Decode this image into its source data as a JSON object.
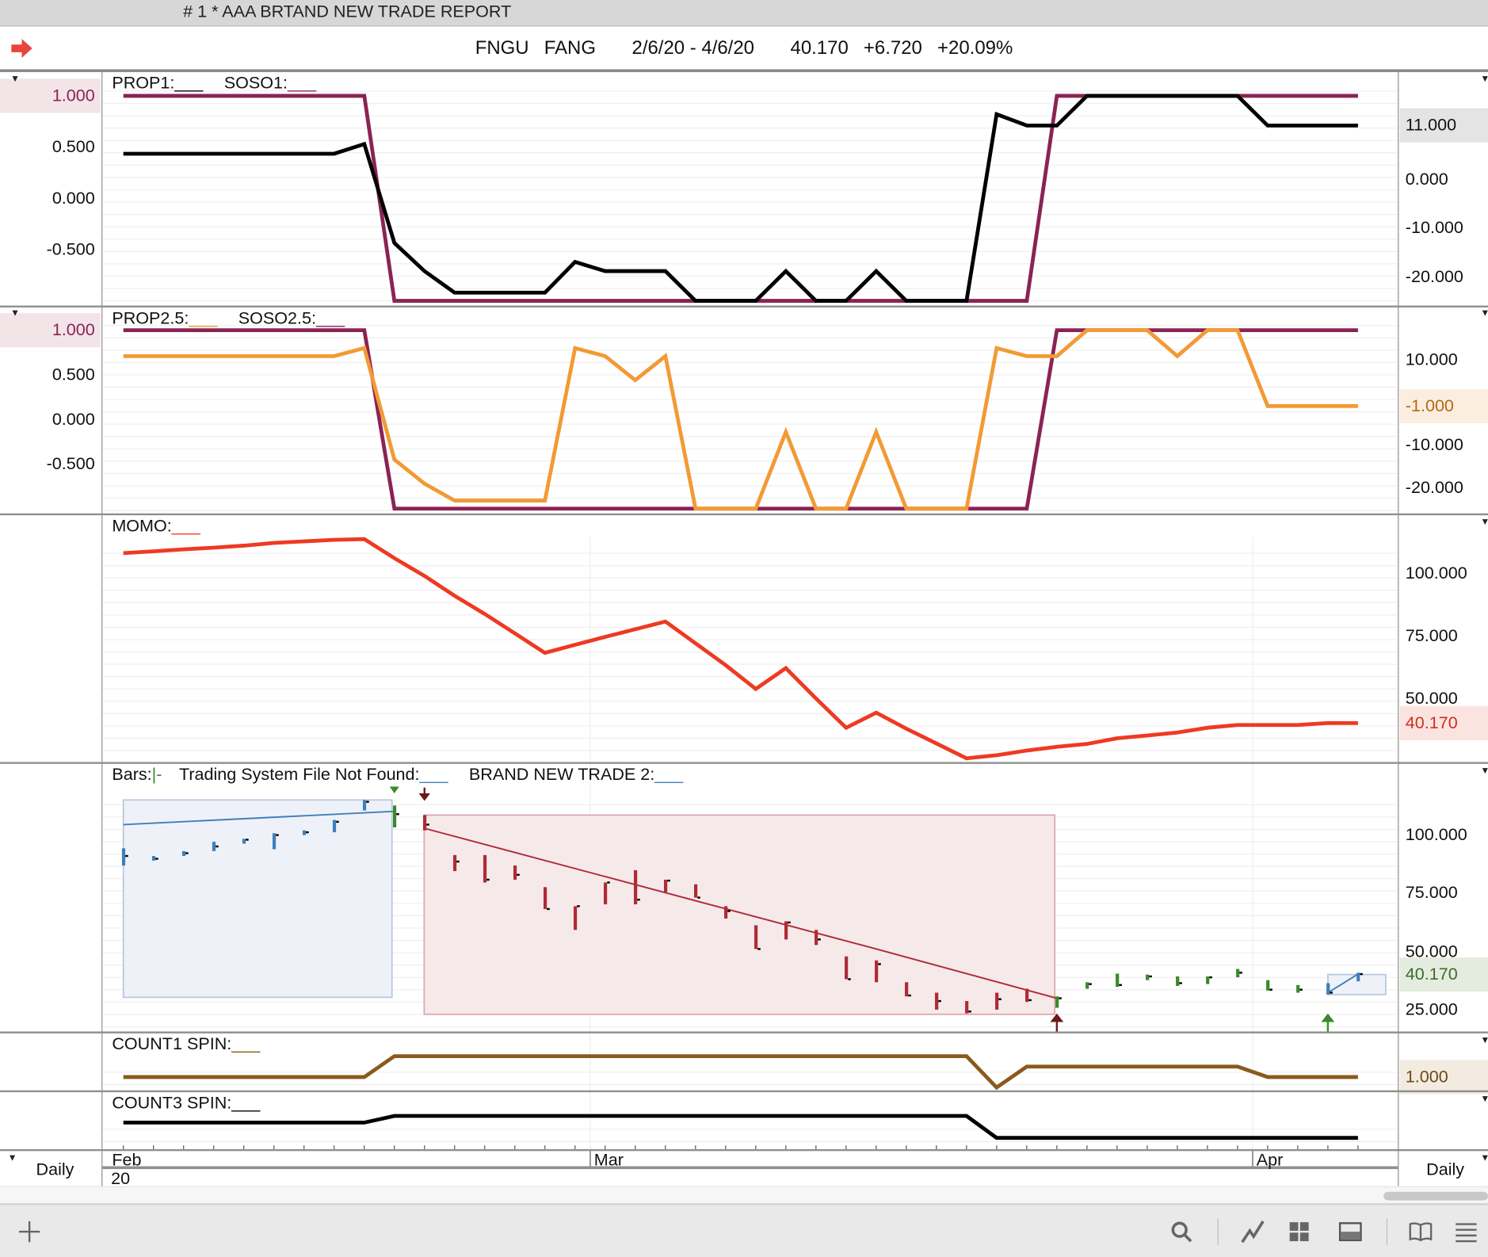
{
  "window": {
    "title": "# 1 * AAA BRTAND NEW TRADE REPORT"
  },
  "header": {
    "symbol": "FNGU",
    "name": "FANG",
    "range": "2/6/20 - 4/6/20",
    "last": "40.170",
    "change": "+6.720",
    "pct": "+20.09%",
    "icon": "red-arrow-right-icon"
  },
  "colors": {
    "purple": "#8b2354",
    "black": "#000000",
    "orange": "#f29a35",
    "momo": "#ee3a22",
    "blue": "#3f7fba",
    "green": "#3a8a2a",
    "red": "#b02a36",
    "brown": "#8a5a1c",
    "arrow_dark": "#6b1a1a"
  },
  "x_axis": {
    "months": [
      "Feb",
      "Mar",
      "Apr"
    ],
    "year": "20",
    "period_left": "Daily",
    "period_right": "Daily",
    "days": 42
  },
  "toolbar": {
    "icons": [
      "plus-icon",
      "search-icon",
      "line-chart-icon",
      "grid-icon",
      "panel-icon",
      "book-icon",
      "list-icon"
    ]
  },
  "chart_data": [
    {
      "id": "p1",
      "type": "line",
      "legend": [
        {
          "label": "PROP1:",
          "swatch": "___"
        },
        {
          "label": "SOSO1:",
          "swatch": "___"
        }
      ],
      "left_ticks": [
        "1.000",
        "0.500",
        "0.000",
        "-0.500"
      ],
      "right_ticks": [
        "11.000",
        "0.000",
        "-10.000",
        "-20.000"
      ],
      "ylim": [
        -1,
        1
      ],
      "series": [
        {
          "name": "SOSO1",
          "color": "purple",
          "values": [
            1,
            1,
            1,
            1,
            1,
            1,
            1,
            1,
            1,
            -1,
            -1,
            -1,
            -1,
            -1,
            -1,
            -1,
            -1,
            -1,
            -1,
            -1,
            -1,
            -1,
            -1,
            -1,
            -1,
            -1,
            -1,
            -1,
            -1,
            -1,
            -1,
            1,
            1,
            1,
            1,
            1,
            1,
            1,
            1,
            1,
            1,
            1
          ]
        },
        {
          "name": "PROP1",
          "color": "black",
          "values": [
            0.435,
            0.435,
            0.435,
            0.435,
            0.435,
            0.435,
            0.435,
            0.435,
            0.53,
            -0.435,
            -0.71,
            -0.92,
            -0.92,
            -0.92,
            -0.92,
            -0.62,
            -0.71,
            -0.71,
            -0.71,
            -1,
            -1,
            -1,
            -0.71,
            -1,
            -1,
            -0.71,
            -1,
            -1,
            -1,
            0.82,
            0.71,
            0.71,
            1,
            1,
            1,
            1,
            1,
            1,
            0.71,
            0.71,
            0.71,
            0.71
          ]
        }
      ]
    },
    {
      "id": "p2",
      "type": "line",
      "legend": [
        {
          "label": "PROP2.5:",
          "swatch": "___"
        },
        {
          "label": "SOSO2.5:",
          "swatch": "___"
        }
      ],
      "left_ticks": [
        "1.000",
        "0.500",
        "0.000",
        "-0.500"
      ],
      "right_ticks": [
        "10.000",
        "-1.000",
        "-10.000",
        "-20.000"
      ],
      "ylim": [
        -1,
        1
      ],
      "series": [
        {
          "name": "SOSO2.5",
          "color": "purple",
          "values": [
            1,
            1,
            1,
            1,
            1,
            1,
            1,
            1,
            1,
            -1,
            -1,
            -1,
            -1,
            -1,
            -1,
            -1,
            -1,
            -1,
            -1,
            -1,
            -1,
            -1,
            -1,
            -1,
            -1,
            -1,
            -1,
            -1,
            -1,
            -1,
            -1,
            1,
            1,
            1,
            1,
            1,
            1,
            1,
            1,
            1,
            1,
            1
          ]
        },
        {
          "name": "PROP2.5",
          "color": "orange",
          "values": [
            0.71,
            0.71,
            0.71,
            0.71,
            0.71,
            0.71,
            0.71,
            0.71,
            0.8,
            -0.45,
            -0.72,
            -0.91,
            -0.91,
            -0.91,
            -0.91,
            0.8,
            0.71,
            0.44,
            0.71,
            -1,
            -1,
            -1,
            -0.14,
            -1,
            -1,
            -0.14,
            -1,
            -1,
            -1,
            0.8,
            0.71,
            0.71,
            1,
            1,
            1,
            0.71,
            1,
            1,
            0.15,
            0.15,
            0.15,
            0.15
          ]
        }
      ]
    },
    {
      "id": "p3",
      "type": "line",
      "legend": [
        {
          "label": "MOMO:",
          "swatch": "___"
        }
      ],
      "right_ticks": [
        "100.000",
        "75.000",
        "50.000",
        "40.170"
      ],
      "series": [
        {
          "name": "MOMO",
          "color": "momo",
          "values": [
            108,
            108.7,
            109.5,
            110.2,
            111,
            112.1,
            112.7,
            113.3,
            113.6,
            106,
            98.9,
            91,
            83.7,
            76,
            68.2,
            71.4,
            74.6,
            77.6,
            80.7,
            72,
            63.3,
            53.8,
            62.1,
            50,
            38.3,
            44.3,
            37.9,
            32,
            26.1,
            27.3,
            29.2,
            30.7,
            31.8,
            34.1,
            35.2,
            36.4,
            38.3,
            39.4,
            39.4,
            39.4,
            40.2,
            40.17
          ]
        }
      ]
    },
    {
      "id": "p4",
      "type": "bar",
      "legend": {
        "bars_label": "Bars:",
        "bars_glyph": "|-",
        "items": [
          {
            "label": "Trading System File Not Found:",
            "swatch": "___"
          },
          {
            "label": "BRAND NEW TRADE 2:",
            "swatch": "___"
          }
        ]
      },
      "right_ticks": [
        "100.000",
        "75.000",
        "50.000",
        "40.170",
        "25.000"
      ],
      "bars_hlc_color": [
        [
          94.3,
          86.9,
          91.0,
          "blue"
        ],
        [
          91.0,
          89.0,
          89.8,
          "blue"
        ],
        [
          93.1,
          91.0,
          92.2,
          "blue"
        ],
        [
          97.1,
          93.1,
          95.1,
          "blue"
        ],
        [
          98.4,
          96.3,
          98.0,
          "blue"
        ],
        [
          100.8,
          93.9,
          100,
          "blue"
        ],
        [
          102,
          100,
          101.2,
          "blue"
        ],
        [
          106.5,
          101.2,
          105.7,
          "blue"
        ],
        [
          115.1,
          110.6,
          114.3,
          "blue"
        ],
        [
          112.7,
          103.3,
          109,
          "green"
        ],
        [
          108.6,
          102,
          104.5,
          "red"
        ],
        [
          91.4,
          84.5,
          88.6,
          "red"
        ],
        [
          91.4,
          79.6,
          80.8,
          "red"
        ],
        [
          86.9,
          80.8,
          82.9,
          "red"
        ],
        [
          77.6,
          68.2,
          68.2,
          "red"
        ],
        [
          69.4,
          59.2,
          69.4,
          "red"
        ],
        [
          79.6,
          70.2,
          79.6,
          "red"
        ],
        [
          84.9,
          70.2,
          72.2,
          "red"
        ],
        [
          80.8,
          75.5,
          80.4,
          "red"
        ],
        [
          78.8,
          73.1,
          73.1,
          "red"
        ],
        [
          69.4,
          64.1,
          67.3,
          "red"
        ],
        [
          61.2,
          51,
          51,
          "red"
        ],
        [
          62.9,
          55.1,
          62.4,
          "red"
        ],
        [
          59.2,
          52.7,
          55.1,
          "red"
        ],
        [
          47.8,
          38,
          38,
          "red"
        ],
        [
          46.1,
          36.7,
          44.5,
          "red"
        ],
        [
          36.7,
          30.6,
          31,
          "red"
        ],
        [
          32.2,
          24.9,
          28.6,
          "red"
        ],
        [
          28.6,
          23.3,
          24.1,
          "red"
        ],
        [
          32.2,
          24.9,
          29.4,
          "red"
        ],
        [
          33.9,
          28.2,
          29,
          "red"
        ],
        [
          30.6,
          25.7,
          29.8,
          "green"
        ],
        [
          36.7,
          33.9,
          35.9,
          "green"
        ],
        [
          40.4,
          34.7,
          35.5,
          "green"
        ],
        [
          40,
          37.6,
          39.2,
          "green"
        ],
        [
          39.2,
          35.1,
          36.3,
          "green"
        ],
        [
          39.2,
          35.9,
          38.8,
          "green"
        ],
        [
          42.4,
          38.8,
          40.8,
          "green"
        ],
        [
          37.6,
          33.1,
          33.5,
          "green"
        ],
        [
          35.5,
          32.2,
          33.5,
          "green"
        ],
        [
          36.3,
          31.4,
          32.2,
          "blue"
        ],
        [
          40.8,
          37.1,
          40.2,
          "blue"
        ]
      ],
      "zones": [
        {
          "from": 0,
          "to": 8.92,
          "hi": 115.1,
          "lo": 30.2,
          "color": "blue"
        },
        {
          "from": 9.99,
          "to": 30.93,
          "hi": 108.6,
          "lo": 22.9,
          "color": "red"
        },
        {
          "from": 40,
          "to": 41.92,
          "hi": 40,
          "lo": 31.4,
          "color": "blue"
        }
      ],
      "trendlines": [
        {
          "points": [
            [
              0,
              104.5
            ],
            [
              9,
              110.2
            ]
          ],
          "color": "blue"
        },
        {
          "points": [
            [
              10,
              102.9
            ],
            [
              25,
              51
            ],
            [
              31,
              29.8
            ]
          ],
          "color": "red"
        },
        {
          "points": [
            [
              40,
              32.2
            ],
            [
              41,
              40.2
            ]
          ],
          "color": "blue"
        }
      ],
      "signals": [
        {
          "type": "triangle-down",
          "index": 9,
          "color": "green"
        },
        {
          "type": "arrow-down",
          "index": 10,
          "color": "arrow_dark"
        },
        {
          "type": "arrow-up",
          "index": 31,
          "color": "arrow_dark"
        },
        {
          "type": "arrow-up",
          "index": 40,
          "color": "green"
        }
      ]
    },
    {
      "id": "p5",
      "type": "line",
      "legend": [
        {
          "label": "COUNT1 SPIN:",
          "swatch": "___"
        }
      ],
      "right_ticks": [
        "1.000"
      ],
      "series": [
        {
          "name": "COUNT1 SPIN",
          "color": "brown",
          "values": [
            1,
            1,
            1,
            1,
            1,
            1,
            1,
            1,
            1,
            3,
            3,
            3,
            3,
            3,
            3,
            3,
            3,
            3,
            3,
            3,
            3,
            3,
            3,
            3,
            3,
            3,
            3,
            3,
            3,
            0,
            2,
            2,
            2,
            2,
            2,
            2,
            2,
            2,
            1,
            1,
            1,
            1
          ]
        }
      ]
    },
    {
      "id": "p6",
      "type": "line",
      "legend": [
        {
          "label": "COUNT3 SPIN:",
          "swatch": "___"
        }
      ],
      "series": [
        {
          "name": "COUNT3 SPIN",
          "color": "black",
          "values": [
            1,
            1,
            1,
            1,
            1,
            1,
            1,
            1,
            1,
            2,
            2,
            2,
            2,
            2,
            2,
            2,
            2,
            2,
            2,
            2,
            2,
            2,
            2,
            2,
            2,
            2,
            2,
            2,
            2,
            -1.3,
            -1.3,
            -1.3,
            -1.3,
            -1.3,
            -1.3,
            -1.3,
            -1.3,
            -1.3,
            -1.3,
            -1.3,
            -1.3,
            -1.3
          ]
        }
      ]
    }
  ]
}
